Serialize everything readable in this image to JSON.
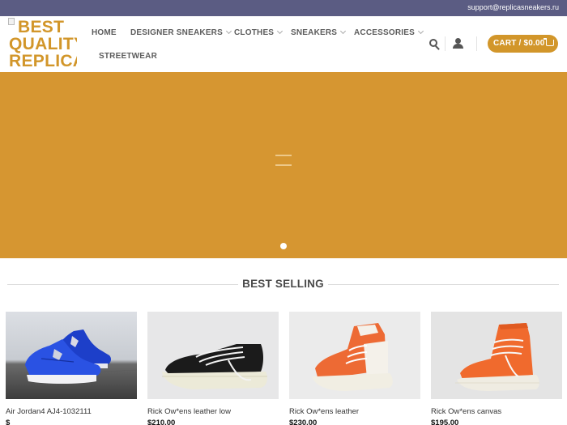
{
  "topbar": {
    "email": "support@replicasneakers.ru"
  },
  "logo": {
    "line1": "BEST",
    "line2": "QUALITY",
    "line3": "REPLICA"
  },
  "nav": {
    "items": [
      {
        "label": "HOME",
        "dropdown": false
      },
      {
        "label": "DESIGNER SNEAKERS",
        "dropdown": true
      },
      {
        "label": "CLOTHES",
        "dropdown": true
      },
      {
        "label": "SNEAKERS",
        "dropdown": true
      },
      {
        "label": "ACCESSORIES",
        "dropdown": true
      },
      {
        "label": "STREETWEAR",
        "dropdown": false
      }
    ]
  },
  "header_icons": [
    "search-icon",
    "user-icon"
  ],
  "cart": {
    "label": "CART / $0.00",
    "icon": "cart-icon"
  },
  "hero": {
    "background": "#d69631",
    "slide_count": 1,
    "active_slide": 1
  },
  "colors": {
    "accent": "#d2962a",
    "topbar": "#5b5c83"
  },
  "section": {
    "title": "BEST SELLING"
  },
  "products": [
    {
      "name": "Air Jordan4 AJ4-1032111",
      "price": "$"
    },
    {
      "name": "Rick Ow*ens leather low",
      "price": "$210.00"
    },
    {
      "name": "Rick Ow*ens leather",
      "price": "$230.00"
    },
    {
      "name": "Rick Ow*ens canvas",
      "price": "$195.00"
    }
  ]
}
